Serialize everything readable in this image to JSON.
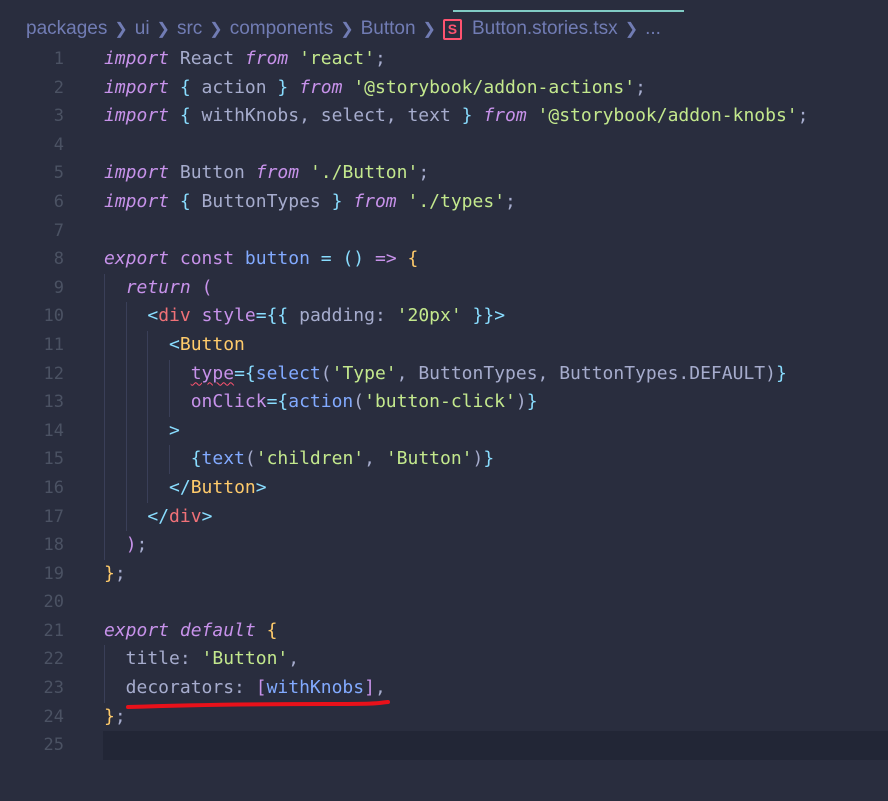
{
  "breadcrumb": {
    "parts": [
      "packages",
      "ui",
      "src",
      "components",
      "Button"
    ],
    "file_icon_glyph": "S",
    "file": "Button.stories.tsx",
    "more": "..."
  },
  "code_lines": [
    {
      "n": "1",
      "tokens": [
        [
          "kw",
          "import"
        ],
        [
          "pl",
          " React "
        ],
        [
          "kw",
          "from"
        ],
        [
          "pl",
          " "
        ],
        [
          "str",
          "'react'"
        ],
        [
          "pl",
          ";"
        ]
      ]
    },
    {
      "n": "2",
      "tokens": [
        [
          "kw",
          "import"
        ],
        [
          "pl",
          " "
        ],
        [
          "op",
          "{"
        ],
        [
          "pl",
          " action "
        ],
        [
          "op",
          "}"
        ],
        [
          "pl",
          " "
        ],
        [
          "kw",
          "from"
        ],
        [
          "pl",
          " "
        ],
        [
          "str",
          "'@storybook/addon-actions'"
        ],
        [
          "pl",
          ";"
        ]
      ]
    },
    {
      "n": "3",
      "tokens": [
        [
          "kw",
          "import"
        ],
        [
          "pl",
          " "
        ],
        [
          "op",
          "{"
        ],
        [
          "pl",
          " withKnobs, select, text "
        ],
        [
          "op",
          "}"
        ],
        [
          "pl",
          " "
        ],
        [
          "kw",
          "from"
        ],
        [
          "pl",
          " "
        ],
        [
          "str",
          "'@storybook/addon-knobs'"
        ],
        [
          "pl",
          ";"
        ]
      ]
    },
    {
      "n": "4",
      "tokens": []
    },
    {
      "n": "5",
      "tokens": [
        [
          "kw",
          "import"
        ],
        [
          "pl",
          " Button "
        ],
        [
          "kw",
          "from"
        ],
        [
          "pl",
          " "
        ],
        [
          "str",
          "'./Button'"
        ],
        [
          "pl",
          ";"
        ]
      ]
    },
    {
      "n": "6",
      "tokens": [
        [
          "kw",
          "import"
        ],
        [
          "pl",
          " "
        ],
        [
          "op",
          "{"
        ],
        [
          "pl",
          " ButtonTypes "
        ],
        [
          "op",
          "}"
        ],
        [
          "pl",
          " "
        ],
        [
          "kw",
          "from"
        ],
        [
          "pl",
          " "
        ],
        [
          "str",
          "'./types'"
        ],
        [
          "pl",
          ";"
        ]
      ]
    },
    {
      "n": "7",
      "tokens": []
    },
    {
      "n": "8",
      "tokens": [
        [
          "kw",
          "export"
        ],
        [
          "pl",
          " "
        ],
        [
          "kwn",
          "const"
        ],
        [
          "pl",
          " "
        ],
        [
          "fn",
          "button"
        ],
        [
          "pl",
          " "
        ],
        [
          "op",
          "="
        ],
        [
          "pl",
          " "
        ],
        [
          "op",
          "()"
        ],
        [
          "pl",
          " "
        ],
        [
          "kwn",
          "=>"
        ],
        [
          "pl",
          " "
        ],
        [
          "prop",
          "{"
        ]
      ]
    },
    {
      "n": "9",
      "tokens": [
        [
          "pl",
          "  "
        ],
        [
          "kw",
          "return"
        ],
        [
          "pl",
          " "
        ],
        [
          "kwn",
          "("
        ]
      ]
    },
    {
      "n": "10",
      "tokens": [
        [
          "pl",
          "    "
        ],
        [
          "op",
          "<"
        ],
        [
          "tag",
          "div"
        ],
        [
          "pl",
          " "
        ],
        [
          "attr",
          "style"
        ],
        [
          "op",
          "={{"
        ],
        [
          "pl",
          " padding: "
        ],
        [
          "str",
          "'20px'"
        ],
        [
          "pl",
          " "
        ],
        [
          "op",
          "}}>"
        ]
      ]
    },
    {
      "n": "11",
      "tokens": [
        [
          "pl",
          "      "
        ],
        [
          "op",
          "<"
        ],
        [
          "prop",
          "Button"
        ]
      ]
    },
    {
      "n": "12",
      "tokens": [
        [
          "pl",
          "        "
        ],
        [
          "attr",
          "type",
          "squiggle"
        ],
        [
          "op",
          "={"
        ],
        [
          "fn",
          "select"
        ],
        [
          "pl",
          "("
        ],
        [
          "str",
          "'Type'"
        ],
        [
          "pl",
          ", ButtonTypes, ButtonTypes.DEFAULT)"
        ],
        [
          "op",
          "}"
        ]
      ]
    },
    {
      "n": "13",
      "tokens": [
        [
          "pl",
          "        "
        ],
        [
          "attr",
          "onClick"
        ],
        [
          "op",
          "={"
        ],
        [
          "fn",
          "action"
        ],
        [
          "pl",
          "("
        ],
        [
          "str",
          "'button-click'"
        ],
        [
          "pl",
          ")"
        ],
        [
          "op",
          "}"
        ]
      ]
    },
    {
      "n": "14",
      "tokens": [
        [
          "pl",
          "      "
        ],
        [
          "op",
          ">"
        ]
      ]
    },
    {
      "n": "15",
      "tokens": [
        [
          "pl",
          "        "
        ],
        [
          "op",
          "{"
        ],
        [
          "fn",
          "text"
        ],
        [
          "pl",
          "("
        ],
        [
          "str",
          "'children'"
        ],
        [
          "pl",
          ", "
        ],
        [
          "str",
          "'Button'"
        ],
        [
          "pl",
          ")"
        ],
        [
          "op",
          "}"
        ]
      ]
    },
    {
      "n": "16",
      "tokens": [
        [
          "pl",
          "      "
        ],
        [
          "op",
          "</"
        ],
        [
          "prop",
          "Button"
        ],
        [
          "op",
          ">"
        ]
      ]
    },
    {
      "n": "17",
      "tokens": [
        [
          "pl",
          "    "
        ],
        [
          "op",
          "</"
        ],
        [
          "tag",
          "div"
        ],
        [
          "op",
          ">"
        ]
      ]
    },
    {
      "n": "18",
      "tokens": [
        [
          "pl",
          "  "
        ],
        [
          "kwn",
          ")"
        ],
        [
          "pl",
          ";"
        ]
      ]
    },
    {
      "n": "19",
      "tokens": [
        [
          "prop",
          "}"
        ],
        [
          "pl",
          ";"
        ]
      ]
    },
    {
      "n": "20",
      "tokens": []
    },
    {
      "n": "21",
      "tokens": [
        [
          "kw",
          "export"
        ],
        [
          "pl",
          " "
        ],
        [
          "kw",
          "default"
        ],
        [
          "pl",
          " "
        ],
        [
          "prop",
          "{"
        ]
      ]
    },
    {
      "n": "22",
      "tokens": [
        [
          "pl",
          "  title: "
        ],
        [
          "str",
          "'Button'"
        ],
        [
          "pl",
          ","
        ]
      ]
    },
    {
      "n": "23",
      "tokens": [
        [
          "pl",
          "  decorators: "
        ],
        [
          "brk",
          "["
        ],
        [
          "fn",
          "withKnobs"
        ],
        [
          "brk",
          "]"
        ],
        [
          "pl",
          ","
        ]
      ]
    },
    {
      "n": "24",
      "tokens": [
        [
          "prop",
          "}"
        ],
        [
          "pl",
          ";"
        ]
      ]
    },
    {
      "n": "25",
      "tokens": [],
      "current": true
    }
  ],
  "colors": {
    "background": "#292d3e",
    "annotation": "#e8111a",
    "tab_accent": "#80cbc4"
  }
}
